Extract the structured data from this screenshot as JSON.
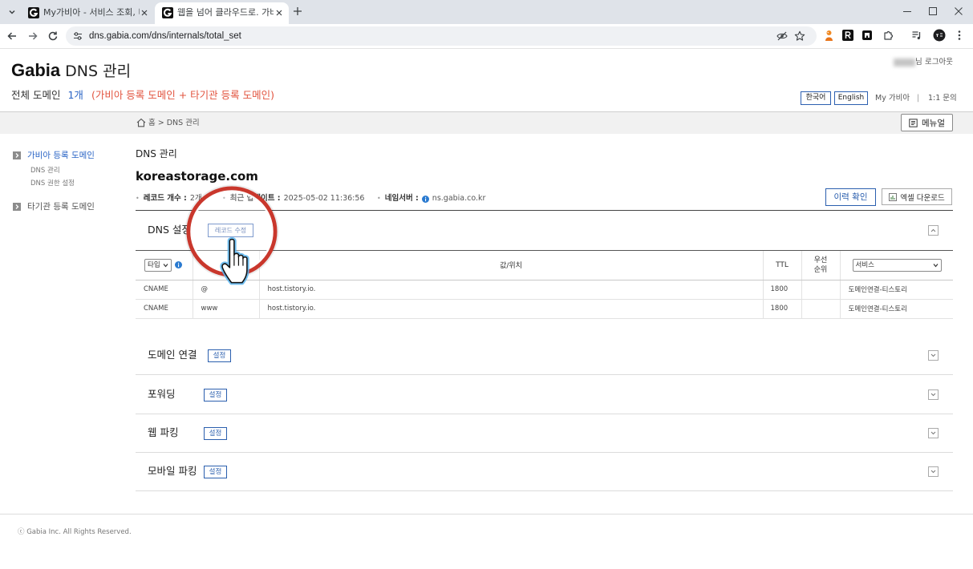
{
  "browser": {
    "tabs": [
      {
        "title": "My가비아 - 서비스 조회, 비용"
      },
      {
        "title": "웹을 넘어 클라우드로. 가비아"
      }
    ],
    "url": "dns.gabia.com/dns/internals/total_set"
  },
  "header": {
    "brand": "Gabia",
    "title": "DNS 관리",
    "user_suffix": "님",
    "logout": "로그아웃",
    "total_label": "전체 도메인",
    "total_count": "1개",
    "total_desc": "(가비아 등록 도메인 + 타기관 등록 도메인)",
    "lang_ko": "한국어",
    "lang_en": "English",
    "my_gabia": "My 가비아",
    "divider": "|",
    "inquiry": "1:1 문의"
  },
  "breadcrumb": {
    "home": "홈",
    "sep": ">",
    "current": "DNS 관리"
  },
  "manual_button": "메뉴얼",
  "sidebar": {
    "groups": [
      {
        "label": "가비아 등록 도메인",
        "items": [
          "DNS 관리",
          "DNS 권한 설정"
        ]
      },
      {
        "label": "타기관 등록 도메인"
      }
    ]
  },
  "main": {
    "page_title": "DNS 관리",
    "domain": "koreastorage.com",
    "info": {
      "record_count_label": "레코드 개수 :",
      "record_count": "2개",
      "updated_label": "최근 업데이트 :",
      "updated": "2025-05-02 11:36:56",
      "nameserver_label": "네임서버 :",
      "nameserver": "ns.gabia.co.kr"
    },
    "history_button": "이력 확인",
    "excel_button": "엑셀 다운로드"
  },
  "dns": {
    "title": "DNS 설정",
    "edit_button": "레코드 수정",
    "columns": {
      "type_select": "타입",
      "value": "값/위치",
      "ttl": "TTL",
      "priority_1": "우선",
      "priority_2": "순위",
      "service_select": "서비스"
    },
    "rows": [
      {
        "type": "CNAME",
        "host": "@",
        "value": "host.tistory.io.",
        "ttl": "1800",
        "service": "도메인연결-티스토리"
      },
      {
        "type": "CNAME",
        "host": "www",
        "value": "host.tistory.io.",
        "ttl": "1800",
        "service": "도메인연결-티스토리"
      }
    ]
  },
  "sections": [
    {
      "title": "도메인 연결",
      "button": "설정"
    },
    {
      "title": "포워딩",
      "button": "설정"
    },
    {
      "title": "웹 파킹",
      "button": "설정"
    },
    {
      "title": "모바일 파킹",
      "button": "설정"
    }
  ],
  "footer": "ⓒ Gabia Inc. All Rights Reserved.",
  "colors": {
    "accent_blue": "#2a64c5",
    "highlight_red": "#e2543f",
    "ring_red": "#c9372c",
    "cursor_glow": "#58b4ee"
  }
}
